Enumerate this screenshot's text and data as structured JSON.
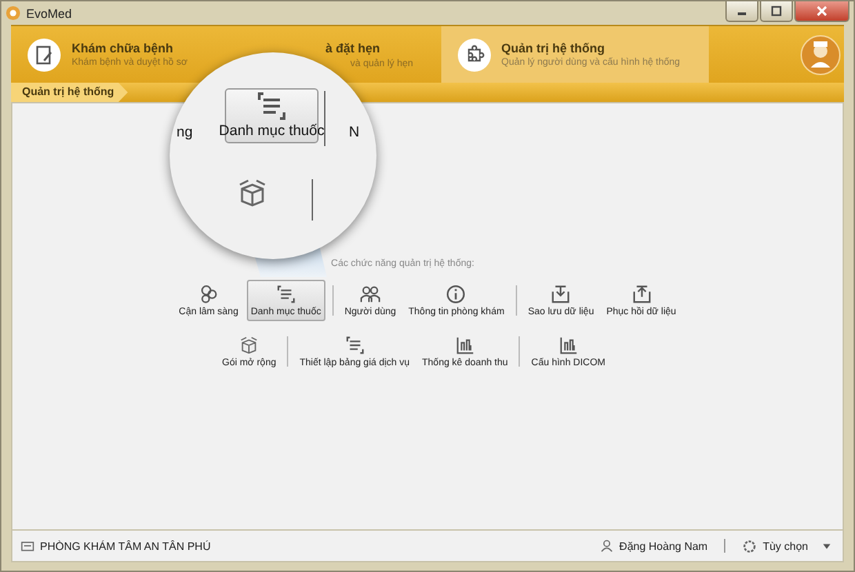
{
  "window": {
    "title": "EvoMed"
  },
  "tabs": [
    {
      "title": "Khám chữa bệnh",
      "subtitle": "Khám bệnh và duyệt hồ sơ",
      "selected": false
    },
    {
      "title": "à đặt hẹn",
      "subtitle": "và quản lý hẹn",
      "selected": false
    },
    {
      "title": "Quản trị hệ thống",
      "subtitle": "Quản lý người dùng và cấu hình hệ thống",
      "selected": true
    }
  ],
  "breadcrumb": "Quản trị hệ thống",
  "section_label": "Các chức năng quản trị hệ thống:",
  "rows": [
    [
      [
        {
          "label": "Cận lâm sàng",
          "selected": false
        },
        {
          "label": "Danh mục thuốc",
          "selected": true
        }
      ],
      [
        {
          "label": "Người dùng",
          "selected": false
        },
        {
          "label": "Thông tin phòng khám",
          "selected": false
        }
      ],
      [
        {
          "label": "Sao lưu dữ liệu",
          "selected": false
        },
        {
          "label": "Phục hồi dữ liệu",
          "selected": false
        }
      ]
    ],
    [
      [
        {
          "label": "Gói mở rộng",
          "selected": false
        }
      ],
      [
        {
          "label": "Thiết lập bảng giá dịch vụ",
          "selected": false
        },
        {
          "label": "Thống kê doanh thu",
          "selected": false
        }
      ],
      [
        {
          "label": "Cấu hình DICOM",
          "selected": false
        }
      ]
    ]
  ],
  "magnifier": {
    "left_text": "ng",
    "button_label": "Danh mục thuốc",
    "right_text": "N"
  },
  "status_bar": {
    "clinic": "PHÒNG KHÁM TÂM AN TÂN PHÚ",
    "user": "Đặng Hoàng Nam",
    "options": "Tùy chọn"
  }
}
